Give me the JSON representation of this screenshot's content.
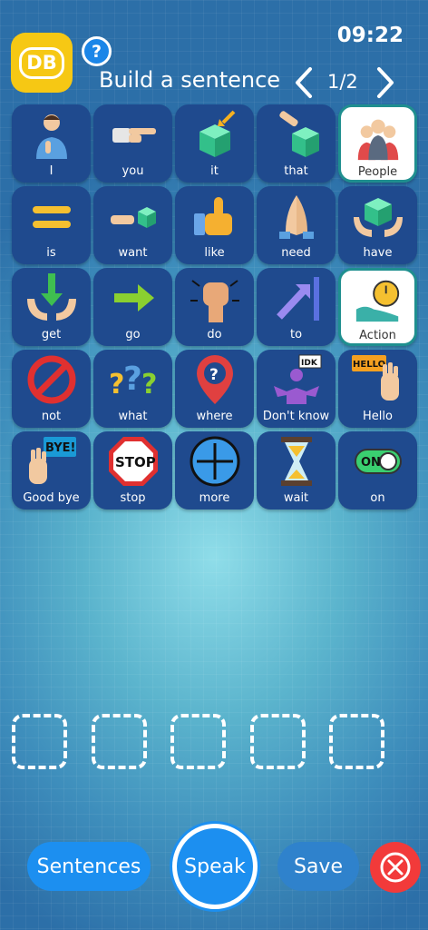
{
  "status": {
    "time": "09:22"
  },
  "header": {
    "logo_text": "DB",
    "help_label": "?",
    "title": "Build a sentence",
    "page_indicator": "1/2"
  },
  "tiles": [
    {
      "label": "I",
      "icon": "person-pointing-self-icon",
      "style": "dark"
    },
    {
      "label": "you",
      "icon": "pointing-hand-icon",
      "style": "dark"
    },
    {
      "label": "it",
      "icon": "cube-with-arrow-icon",
      "style": "dark"
    },
    {
      "label": "that",
      "icon": "hand-pointing-cube-icon",
      "style": "dark"
    },
    {
      "label": "People",
      "icon": "group-of-people-icon",
      "style": "white"
    },
    {
      "label": "is",
      "icon": "equals-icon",
      "style": "dark"
    },
    {
      "label": "want",
      "icon": "hand-reaching-cube-icon",
      "style": "dark"
    },
    {
      "label": "like",
      "icon": "thumbs-up-icon",
      "style": "dark"
    },
    {
      "label": "need",
      "icon": "praying-hands-icon",
      "style": "dark"
    },
    {
      "label": "have",
      "icon": "hands-holding-cube-icon",
      "style": "dark"
    },
    {
      "label": "get",
      "icon": "hands-receiving-arrow-icon",
      "style": "dark"
    },
    {
      "label": "go",
      "icon": "right-arrow-icon",
      "style": "dark"
    },
    {
      "label": "do",
      "icon": "raised-fist-icon",
      "style": "dark"
    },
    {
      "label": "to",
      "icon": "arrow-to-line-icon",
      "style": "dark"
    },
    {
      "label": "Action",
      "icon": "running-shoe-stopwatch-icon",
      "style": "white"
    },
    {
      "label": "not",
      "icon": "prohibited-icon",
      "style": "dark"
    },
    {
      "label": "what",
      "icon": "question-marks-icon",
      "style": "dark"
    },
    {
      "label": "where",
      "icon": "location-pin-question-icon",
      "style": "dark"
    },
    {
      "label": "Don't know",
      "icon": "shrugging-person-idk-icon",
      "style": "dark"
    },
    {
      "label": "Hello",
      "icon": "waving-hand-hello-icon",
      "style": "dark"
    },
    {
      "label": "Good bye",
      "icon": "waving-hand-bye-icon",
      "style": "dark"
    },
    {
      "label": "stop",
      "icon": "stop-sign-icon",
      "style": "dark"
    },
    {
      "label": "more",
      "icon": "plus-circle-icon",
      "style": "dark"
    },
    {
      "label": "wait",
      "icon": "hourglass-icon",
      "style": "dark"
    },
    {
      "label": "on",
      "icon": "toggle-on-icon",
      "style": "dark"
    }
  ],
  "sentence_slots": 5,
  "icon_texts": {
    "idk": "IDK",
    "hello": "HELLO",
    "bye": "BYE!",
    "stop": "STOP",
    "on": "ON"
  },
  "footer": {
    "sentences_label": "Sentences",
    "speak_label": "Speak",
    "save_label": "Save"
  },
  "colors": {
    "tile_dark": "#1f4a8e",
    "tile_white": "#ffffff",
    "accent_blue": "#1c8ff0",
    "close_red": "#f23a3a",
    "logo_yellow": "#f6c814"
  }
}
